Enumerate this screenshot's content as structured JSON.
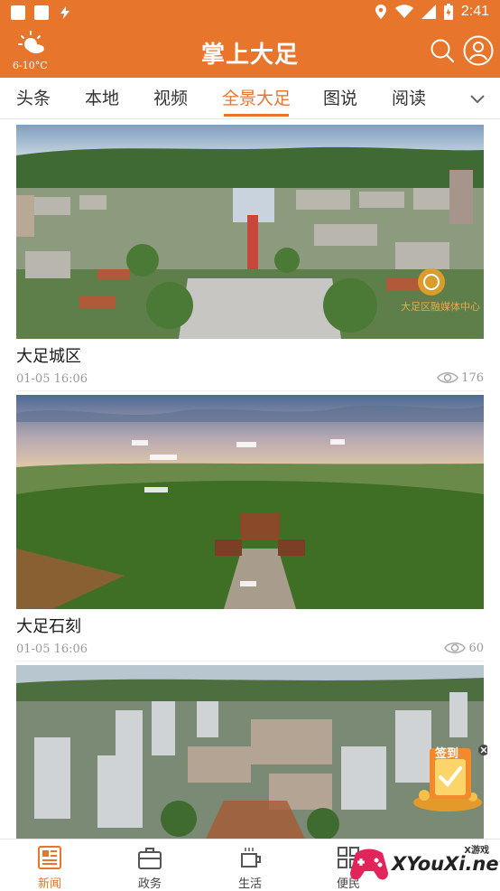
{
  "status_bar": {
    "time": "2:41"
  },
  "header": {
    "weather_temp": "6-10°C",
    "app_title": "掌上大足"
  },
  "tabs": [
    {
      "label": "头条"
    },
    {
      "label": "本地"
    },
    {
      "label": "视频"
    },
    {
      "label": "全景大足",
      "active": true
    },
    {
      "label": "图说"
    },
    {
      "label": "阅读"
    }
  ],
  "feed": [
    {
      "title": "大足城区",
      "time": "01-05 16:06",
      "views": "176",
      "image_watermark": "大足区融媒体中心"
    },
    {
      "title": "大足石刻",
      "time": "01-05 16:06",
      "views": "60"
    },
    {
      "title": "",
      "time": "",
      "views": ""
    }
  ],
  "floating_badge": {
    "label": "签到"
  },
  "bottom_nav": [
    {
      "label": "新闻",
      "icon": "newspaper-icon",
      "active": true
    },
    {
      "label": "政务",
      "icon": "briefcase-icon"
    },
    {
      "label": "生活",
      "icon": "cup-icon"
    },
    {
      "label": "便民",
      "icon": "grid-icon"
    }
  ],
  "watermark": {
    "brand": "XYouXi.net",
    "small": "X游戏"
  },
  "colors": {
    "accent": "#e7752b",
    "text": "#1a1a1a",
    "muted": "#9a9a9a"
  }
}
